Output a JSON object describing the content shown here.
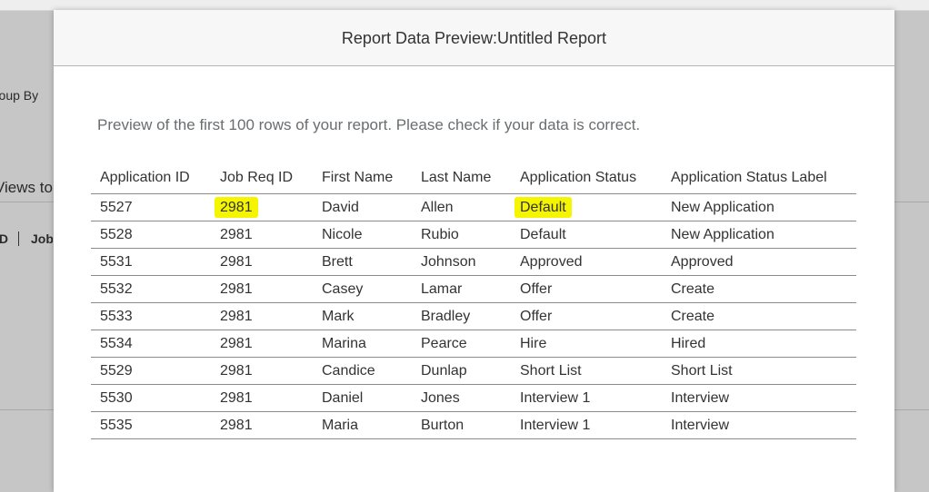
{
  "background": {
    "group_by_label": "Group By",
    "views_label": "Views to",
    "col_id_fragment": "ID",
    "col_job_fragment": "Job"
  },
  "dialog": {
    "title": "Report Data Preview:Untitled Report",
    "intro": "Preview of the first 100 rows of your report. Please check if your data is correct."
  },
  "table": {
    "headers": [
      "Application ID",
      "Job Req ID",
      "First Name",
      "Last Name",
      "Application Status",
      "Application Status Label"
    ],
    "rows": [
      [
        "5527",
        "2981",
        "David",
        "Allen",
        "Default",
        "New Application"
      ],
      [
        "5528",
        "2981",
        "Nicole",
        "Rubio",
        "Default",
        "New Application"
      ],
      [
        "5531",
        "2981",
        "Brett",
        "Johnson",
        "Approved",
        "Approved"
      ],
      [
        "5532",
        "2981",
        "Casey",
        "Lamar",
        "Offer",
        "Create"
      ],
      [
        "5533",
        "2981",
        "Mark",
        "Bradley",
        "Offer",
        "Create"
      ],
      [
        "5534",
        "2981",
        "Marina",
        "Pearce",
        "Hire",
        "Hired"
      ],
      [
        "5529",
        "2981",
        "Candice",
        "Dunlap",
        "Short List",
        "Short List"
      ],
      [
        "5530",
        "2981",
        "Daniel",
        "Jones",
        "Interview 1",
        "Interview"
      ],
      [
        "5535",
        "2981",
        "Maria",
        "Burton",
        "Interview 1",
        "Interview"
      ]
    ]
  },
  "highlight_color": "#f5f500"
}
